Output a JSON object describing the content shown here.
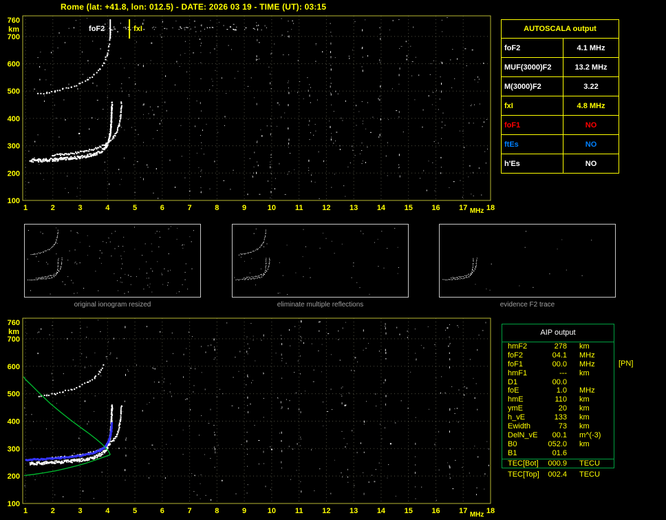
{
  "header": {
    "title": "Rome (lat: +41.8, lon: 012.5) - DATE: 2026 03 19 - TIME (UT): 03:15"
  },
  "colors": {
    "accent_yellow": "#ffff00",
    "axis_border": "#b8b832",
    "grid": "#4f4f40",
    "trace_white": "#ffffff",
    "trace_blue": "#3333ff",
    "profile_green": "#00c030",
    "panel_green": "#00a040",
    "status_red": "#ff0000",
    "status_blue": "#0080ff",
    "caption_gray": "#a0a0a0"
  },
  "autoscala_table": {
    "title": "AUTOSCALA output",
    "rows": [
      {
        "label": "foF2",
        "value": "4.1 MHz",
        "color": "#ffffff"
      },
      {
        "label": "MUF(3000)F2",
        "value": "13.2 MHz",
        "color": "#ffffff"
      },
      {
        "label": "M(3000)F2",
        "value": "3.22",
        "color": "#ffffff"
      },
      {
        "label": "fxI",
        "value": "4.8 MHz",
        "color": "#ffff00"
      },
      {
        "label": "foF1",
        "value": "NO",
        "color": "#ff0000"
      },
      {
        "label": "ftEs",
        "value": "NO",
        "color": "#0080ff"
      },
      {
        "label": "h'Es",
        "value": "NO",
        "color": "#ffffff"
      }
    ]
  },
  "thumbnails": [
    {
      "caption": "original ionogram resized"
    },
    {
      "caption": "eliminate multiple reflections"
    },
    {
      "caption": "evidence F2 trace"
    }
  ],
  "aip_table": {
    "title": "AIP output",
    "rows": [
      {
        "name": "hmF2",
        "value": "278",
        "unit": "km"
      },
      {
        "name": "foF2",
        "value": "04.1",
        "unit": "MHz"
      },
      {
        "name": "foF1",
        "value": "00.0",
        "unit": "MHz",
        "note": "[PN]"
      },
      {
        "name": "hmF1",
        "value": "---",
        "unit": "km"
      },
      {
        "name": "D1",
        "value": "00.0",
        "unit": ""
      },
      {
        "name": "foE",
        "value": "1.0",
        "unit": "MHz"
      },
      {
        "name": "hmE",
        "value": "110",
        "unit": "km"
      },
      {
        "name": "ymE",
        "value": "20",
        "unit": "km"
      },
      {
        "name": "h_vE",
        "value": "133",
        "unit": "km"
      },
      {
        "name": "Ewidth",
        "value": "73",
        "unit": "km"
      },
      {
        "name": "DelN_vE",
        "value": "00.1",
        "unit": "m^(-3)"
      },
      {
        "name": "B0",
        "value": "052.0",
        "unit": "km"
      },
      {
        "name": "B1",
        "value": "01.6",
        "unit": ""
      }
    ],
    "tec_rows": [
      {
        "name": "TEC[Bot]",
        "value": "000.9",
        "unit": "TECU"
      },
      {
        "name": "TEC[Top]",
        "value": "002.4",
        "unit": "TECU"
      }
    ]
  },
  "chart_data": [
    {
      "name": "recorded-ionogram",
      "type": "scatter",
      "xlabel": "MHz",
      "ylabel": "km",
      "xlim": [
        1,
        18
      ],
      "ylim": [
        100,
        760
      ],
      "grid": true,
      "x_ticks": [
        1,
        2,
        3,
        4,
        5,
        6,
        7,
        8,
        9,
        10,
        11,
        12,
        13,
        14,
        15,
        16,
        17,
        18
      ],
      "y_ticks": [
        100,
        200,
        300,
        400,
        500,
        600,
        700,
        760
      ],
      "markers": [
        {
          "label": "foF2",
          "freq": 4.1,
          "color": "#ffffff",
          "side": "left"
        },
        {
          "label": "fxI",
          "freq": 4.8,
          "color": "#ffff00",
          "side": "right"
        }
      ],
      "series": [
        {
          "name": "F2-ordinary-trace",
          "color": "#ffffff",
          "style": "dots-band",
          "points": [
            [
              1.15,
              248
            ],
            [
              1.45,
              249
            ],
            [
              1.75,
              250
            ],
            [
              2.05,
              252
            ],
            [
              2.35,
              254
            ],
            [
              2.65,
              257
            ],
            [
              2.95,
              260
            ],
            [
              3.25,
              265
            ],
            [
              3.5,
              271
            ],
            [
              3.7,
              279
            ],
            [
              3.85,
              290
            ],
            [
              3.95,
              303
            ],
            [
              4.02,
              320
            ],
            [
              4.07,
              343
            ],
            [
              4.1,
              372
            ],
            [
              4.12,
              405
            ],
            [
              4.135,
              438
            ],
            [
              4.14,
              458
            ]
          ]
        },
        {
          "name": "F2-extraordinary-trace",
          "color": "#ffffff",
          "style": "dots",
          "points": [
            [
              1.95,
              267
            ],
            [
              2.25,
              270
            ],
            [
              2.55,
              273
            ],
            [
              2.85,
              277
            ],
            [
              3.15,
              282
            ],
            [
              3.45,
              289
            ],
            [
              3.7,
              298
            ],
            [
              3.9,
              308
            ],
            [
              4.05,
              319
            ],
            [
              4.2,
              334
            ],
            [
              4.32,
              353
            ],
            [
              4.4,
              378
            ],
            [
              4.45,
              408
            ],
            [
              4.48,
              440
            ],
            [
              4.49,
              460
            ]
          ]
        },
        {
          "name": "second-hop-trace",
          "color": "#ffffff",
          "style": "dots-sparse",
          "points": [
            [
              1.45,
              492
            ],
            [
              1.75,
              497
            ],
            [
              2.05,
              502
            ],
            [
              2.35,
              509
            ],
            [
              2.65,
              517
            ],
            [
              2.95,
              528
            ],
            [
              3.25,
              543
            ],
            [
              3.5,
              561
            ],
            [
              3.7,
              582
            ],
            [
              3.85,
              606
            ],
            [
              3.95,
              633
            ],
            [
              4.03,
              664
            ],
            [
              4.08,
              697
            ],
            [
              4.11,
              728
            ]
          ]
        }
      ],
      "noise": {
        "count": 380,
        "columns": [
          5.3,
          7.4,
          9.45,
          9.95,
          10.6,
          11.35,
          12.15,
          13.3,
          13.95,
          14.65,
          16.2
        ],
        "band": {
          "f": [
            3.6,
            9.8
          ],
          "km": [
            724,
            736
          ],
          "count": 50
        }
      }
    },
    {
      "name": "autoscaled-trace-and-electron-density-profile",
      "type": "scatter",
      "xlabel": "MHz",
      "ylabel": "km",
      "xlim": [
        1,
        18
      ],
      "ylim": [
        100,
        760
      ],
      "grid": true,
      "x_ticks": [
        1,
        2,
        3,
        4,
        5,
        6,
        7,
        8,
        9,
        10,
        11,
        12,
        13,
        14,
        15,
        16,
        17,
        18
      ],
      "y_ticks": [
        100,
        200,
        300,
        400,
        500,
        600,
        700,
        760
      ],
      "markers": [],
      "series": [
        {
          "name": "F2-ordinary-trace",
          "color": "#ffffff",
          "style": "dots-band",
          "points": [
            [
              1.15,
              248
            ],
            [
              1.45,
              249
            ],
            [
              1.75,
              250
            ],
            [
              2.05,
              252
            ],
            [
              2.35,
              254
            ],
            [
              2.65,
              257
            ],
            [
              2.95,
              260
            ],
            [
              3.25,
              265
            ],
            [
              3.5,
              271
            ],
            [
              3.7,
              279
            ],
            [
              3.85,
              290
            ],
            [
              3.95,
              303
            ],
            [
              4.02,
              320
            ],
            [
              4.07,
              343
            ],
            [
              4.1,
              372
            ],
            [
              4.12,
              405
            ],
            [
              4.135,
              438
            ],
            [
              4.14,
              458
            ]
          ]
        },
        {
          "name": "F2-extraordinary-trace",
          "color": "#ffffff",
          "style": "dots",
          "points": [
            [
              1.95,
              267
            ],
            [
              2.25,
              270
            ],
            [
              2.55,
              273
            ],
            [
              2.85,
              277
            ],
            [
              3.15,
              282
            ],
            [
              3.45,
              289
            ],
            [
              3.7,
              298
            ],
            [
              3.9,
              308
            ],
            [
              4.05,
              319
            ],
            [
              4.2,
              334
            ],
            [
              4.32,
              353
            ],
            [
              4.4,
              378
            ],
            [
              4.45,
              408
            ],
            [
              4.48,
              440
            ],
            [
              4.49,
              460
            ]
          ]
        },
        {
          "name": "second-hop-trace",
          "color": "#ffffff",
          "style": "dots-sparse",
          "points": [
            [
              1.45,
              492
            ],
            [
              1.75,
              497
            ],
            [
              2.05,
              502
            ],
            [
              2.35,
              509
            ],
            [
              2.65,
              517
            ],
            [
              2.95,
              528
            ],
            [
              3.25,
              543
            ],
            [
              3.5,
              561
            ],
            [
              3.7,
              582
            ],
            [
              3.85,
              606
            ]
          ]
        },
        {
          "name": "scaled-F2-trace",
          "color": "#3333ff",
          "style": "dots-thick",
          "points": [
            [
              1.0,
              263
            ],
            [
              1.3,
              264
            ],
            [
              1.6,
              265
            ],
            [
              1.9,
              267
            ],
            [
              2.2,
              269
            ],
            [
              2.5,
              272
            ],
            [
              2.8,
              275
            ],
            [
              3.05,
              279
            ],
            [
              3.3,
              284
            ],
            [
              3.5,
              290
            ],
            [
              3.7,
              298
            ],
            [
              3.85,
              308
            ],
            [
              3.95,
              320
            ],
            [
              4.03,
              336
            ],
            [
              4.08,
              356
            ],
            [
              4.11,
              378
            ],
            [
              4.13,
              395
            ]
          ]
        },
        {
          "name": "profile-bottomside",
          "color": "#00c030",
          "style": "line",
          "points": [
            [
              0.95,
              202
            ],
            [
              1.3,
              206
            ],
            [
              1.7,
              212
            ],
            [
              2.1,
              219
            ],
            [
              2.5,
              228
            ],
            [
              2.9,
              238
            ],
            [
              3.25,
              248
            ],
            [
              3.55,
              258
            ],
            [
              3.8,
              267
            ],
            [
              3.97,
              273
            ],
            [
              4.1,
              278
            ]
          ]
        },
        {
          "name": "profile-topside",
          "color": "#00c030",
          "style": "line",
          "points": [
            [
              4.1,
              278
            ],
            [
              4.04,
              290
            ],
            [
              3.93,
              303
            ],
            [
              3.78,
              318
            ],
            [
              3.58,
              335
            ],
            [
              3.32,
              355
            ],
            [
              3.0,
              378
            ],
            [
              2.65,
              404
            ],
            [
              2.28,
              433
            ],
            [
              1.9,
              465
            ],
            [
              1.55,
              498
            ],
            [
              1.25,
              528
            ],
            [
              1.0,
              552
            ],
            [
              0.93,
              562
            ]
          ]
        }
      ],
      "noise": {
        "count": 320,
        "columns": [
          4.65,
          7.9,
          9.1,
          9.7,
          10.35,
          11.05,
          12.55,
          13.35,
          14.15,
          15.25,
          16.5
        ]
      }
    }
  ]
}
